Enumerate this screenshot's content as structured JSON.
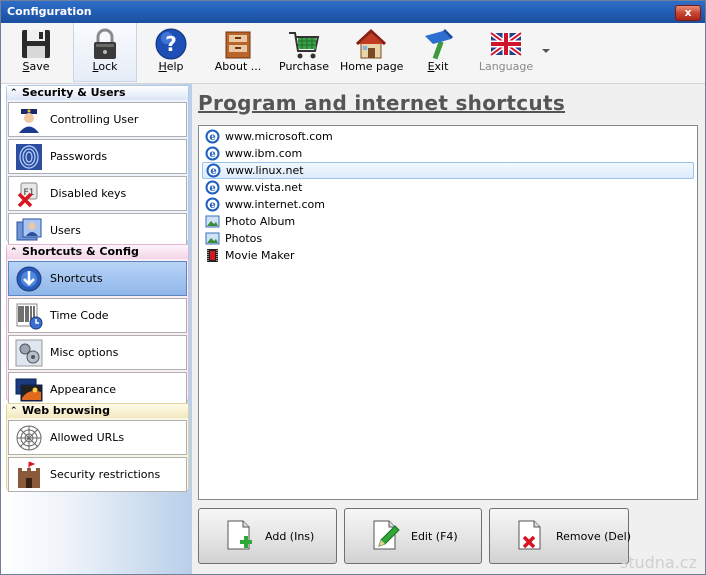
{
  "window": {
    "title": "Configuration",
    "close_label": "x"
  },
  "toolbar": {
    "items": [
      {
        "label": "Save",
        "mnemonic": "S",
        "rest": "ave",
        "icon": "save-icon"
      },
      {
        "label": "Lock",
        "mnemonic": "L",
        "rest": "ock",
        "icon": "lock-icon"
      },
      {
        "label": "Help",
        "mnemonic": "H",
        "rest": "elp",
        "icon": "help-icon"
      },
      {
        "label": "About ...",
        "icon": "about-icon"
      },
      {
        "label": "Purchase",
        "icon": "shopping-cart-icon"
      },
      {
        "label": "Home page",
        "icon": "home-icon"
      },
      {
        "label": "Exit",
        "mnemonic": "E",
        "rest": "xit",
        "icon": "exit-icon"
      },
      {
        "label": "Language",
        "icon": "uk-flag-icon"
      }
    ]
  },
  "sidebar": {
    "groups": [
      {
        "title": "Security & Users",
        "items": [
          {
            "label": "Controlling User",
            "icon": "policeman-icon"
          },
          {
            "label": "Passwords",
            "icon": "fingerprint-icon"
          },
          {
            "label": "Disabled keys",
            "icon": "disabled-keys-icon"
          },
          {
            "label": "Users",
            "icon": "users-icon"
          }
        ]
      },
      {
        "title": "Shortcuts & Config",
        "items": [
          {
            "label": "Shortcuts",
            "icon": "shortcut-arrow-icon",
            "selected": true
          },
          {
            "label": "Time Code",
            "icon": "barcode-clock-icon"
          },
          {
            "label": "Misc options",
            "icon": "misc-options-icon"
          },
          {
            "label": "Appearance",
            "icon": "appearance-icon"
          }
        ]
      },
      {
        "title": "Web browsing",
        "items": [
          {
            "label": "Allowed URLs",
            "icon": "spider-web-icon"
          },
          {
            "label": "Security restrictions",
            "icon": "castle-icon"
          }
        ]
      }
    ]
  },
  "main": {
    "heading": "Program and internet shortcuts",
    "shortcuts": [
      {
        "label": "www.microsoft.com",
        "icon": "ie-icon"
      },
      {
        "label": "www.ibm.com",
        "icon": "ie-icon"
      },
      {
        "label": "www.linux.net",
        "icon": "ie-icon",
        "selected": true
      },
      {
        "label": "www.vista.net",
        "icon": "ie-icon"
      },
      {
        "label": "www.internet.com",
        "icon": "ie-icon"
      },
      {
        "label": "Photo Album",
        "icon": "photo-icon"
      },
      {
        "label": "Photos",
        "icon": "photo-icon"
      },
      {
        "label": "Movie Maker",
        "icon": "film-icon"
      }
    ],
    "buttons": {
      "add": "Add (Ins)",
      "edit": "Edit (F4)",
      "remove": "Remove (Del)"
    }
  },
  "watermark": "studna.cz",
  "colors": {
    "accent": "#235fb8",
    "selection": "#99c4ec"
  }
}
